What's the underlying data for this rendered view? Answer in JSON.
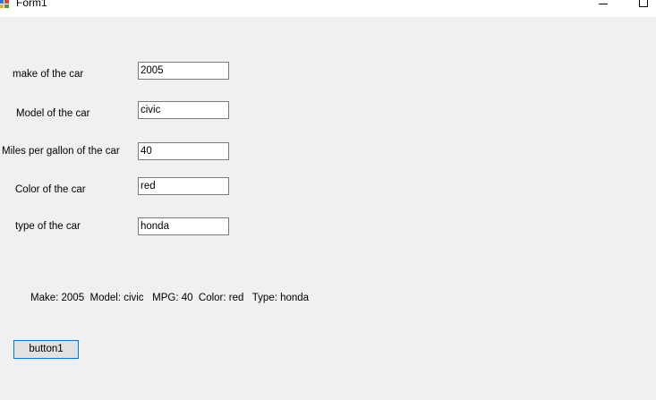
{
  "window": {
    "title": "Form1",
    "icon": "form-icon",
    "controls": [
      "minimize-icon",
      "maximize-icon"
    ]
  },
  "fields": [
    {
      "label": "make of the car",
      "value": "2005"
    },
    {
      "label": "Model of the car",
      "value": "civic"
    },
    {
      "label": "Miles per gallon of the car",
      "value": "40"
    },
    {
      "label": "Color of the car",
      "value": "red"
    },
    {
      "label": "type of the car",
      "value": "honda"
    }
  ],
  "output": {
    "text": "Make: 2005  Model: civic   MPG: 40  Color: red   Type: honda"
  },
  "button": {
    "label": "button1"
  },
  "colors": {
    "form_background": "#f0f0f0",
    "titlebar_background": "#ffffff",
    "textbox_border": "#7a7a7a",
    "button_background": "#e1e1e1",
    "button_focus_border": "#0078d7"
  }
}
